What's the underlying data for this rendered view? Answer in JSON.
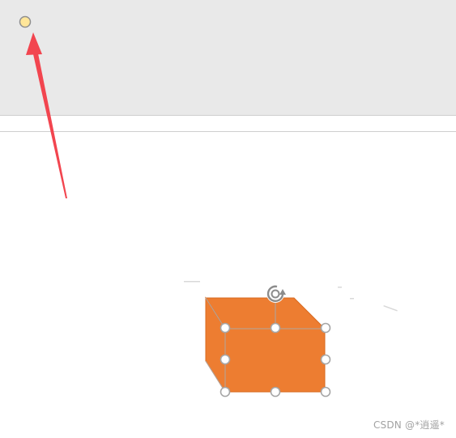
{
  "watermark": {
    "text": "CSDN @*逍遥*"
  },
  "shape": {
    "name": "cube",
    "front_color": "#ed7d31",
    "side_color": "#ed7d31",
    "outline_color": "#d86a20",
    "state": "selected"
  },
  "handles": {
    "color": "#a6a6a6",
    "adjust_handle_color": "#ffe699",
    "rotate_icon": "rotate-icon"
  },
  "annotation": {
    "arrow_color": "#f2454f"
  },
  "colors": {
    "top_band": "#e9e9e9",
    "canvas": "#ffffff",
    "divider": "#cfcfcf"
  }
}
